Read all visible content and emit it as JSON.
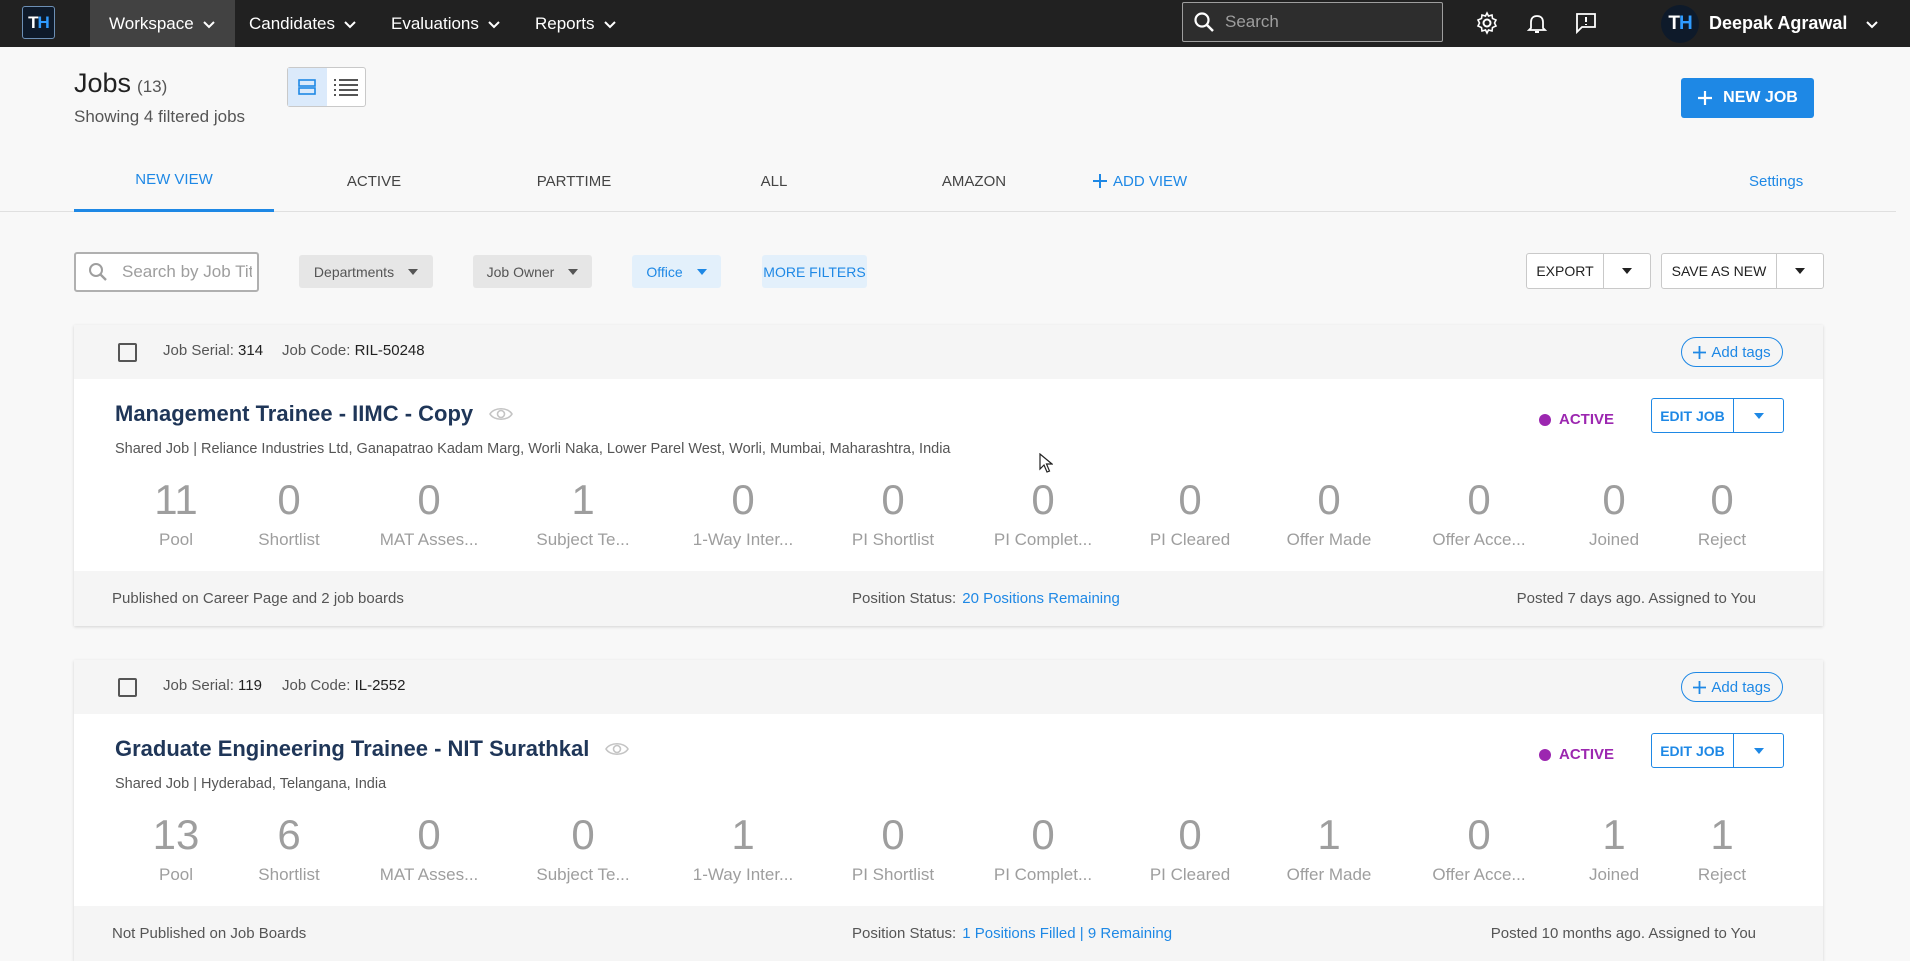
{
  "topbar": {
    "logo_t": "T",
    "logo_h": "H",
    "nav": [
      {
        "label": "Workspace"
      },
      {
        "label": "Candidates"
      },
      {
        "label": "Evaluations"
      },
      {
        "label": "Reports"
      }
    ],
    "search_placeholder": "Search",
    "user_name": "Deepak Agrawal",
    "user_initials_t": "T",
    "user_initials_h": "H"
  },
  "page": {
    "title": "Jobs",
    "count": "(13)",
    "subtitle": "Showing 4 filtered jobs",
    "new_job_label": "NEW JOB"
  },
  "tabs": [
    {
      "label": "NEW VIEW"
    },
    {
      "label": "ACTIVE"
    },
    {
      "label": "PARTTIME"
    },
    {
      "label": "ALL"
    },
    {
      "label": "AMAZON"
    }
  ],
  "add_view_label": "ADD VIEW",
  "settings_label": "Settings",
  "filters": {
    "search_placeholder": "Search by Job Title",
    "departments": "Departments",
    "job_owner": "Job Owner",
    "office": "Office",
    "more_filters": "MORE FILTERS",
    "export": "EXPORT",
    "save_as_new": "SAVE AS NEW"
  },
  "jobs": [
    {
      "serial_label": "Job Serial:",
      "serial": "314",
      "code_label": "Job Code:",
      "code": "RIL-50248",
      "add_tags": "Add tags",
      "title": "Management Trainee - IIMC - Copy",
      "location": "Shared Job | Reliance Industries Ltd, Ganapatrao Kadam Marg, Worli Naka, Lower Parel West, Worli, Mumbai, Maharashtra, India",
      "status": "ACTIVE",
      "edit": "EDIT JOB",
      "stages": [
        {
          "num": "11",
          "label": "Pool"
        },
        {
          "num": "0",
          "label": "Shortlist"
        },
        {
          "num": "0",
          "label": "MAT Asses..."
        },
        {
          "num": "1",
          "label": "Subject Te..."
        },
        {
          "num": "0",
          "label": "1-Way Inter..."
        },
        {
          "num": "0",
          "label": "PI Shortlist"
        },
        {
          "num": "0",
          "label": "PI Complet..."
        },
        {
          "num": "0",
          "label": "PI Cleared"
        },
        {
          "num": "0",
          "label": "Offer Made"
        },
        {
          "num": "0",
          "label": "Offer Acce..."
        },
        {
          "num": "0",
          "label": "Joined"
        },
        {
          "num": "0",
          "label": "Reject"
        }
      ],
      "footer_left": "Published on Career Page and 2 job boards",
      "position_label": "Position Status:",
      "position_value": "20 Positions Remaining",
      "footer_right": "Posted 7 days ago. Assigned to You"
    },
    {
      "serial_label": "Job Serial:",
      "serial": "119",
      "code_label": "Job Code:",
      "code": "IL-2552",
      "add_tags": "Add tags",
      "title": "Graduate Engineering Trainee - NIT Surathkal",
      "location": "Shared Job | Hyderabad, Telangana, India",
      "status": "ACTIVE",
      "edit": "EDIT JOB",
      "stages": [
        {
          "num": "13",
          "label": "Pool"
        },
        {
          "num": "6",
          "label": "Shortlist"
        },
        {
          "num": "0",
          "label": "MAT Asses..."
        },
        {
          "num": "0",
          "label": "Subject Te..."
        },
        {
          "num": "1",
          "label": "1-Way Inter..."
        },
        {
          "num": "0",
          "label": "PI Shortlist"
        },
        {
          "num": "0",
          "label": "PI Complet..."
        },
        {
          "num": "0",
          "label": "PI Cleared"
        },
        {
          "num": "1",
          "label": "Offer Made"
        },
        {
          "num": "0",
          "label": "Offer Acce..."
        },
        {
          "num": "1",
          "label": "Joined"
        },
        {
          "num": "1",
          "label": "Reject"
        }
      ],
      "footer_left": "Not Published on Job Boards",
      "position_label": "Position Status:",
      "position_value": "1 Positions Filled | 9 Remaining",
      "footer_right": "Posted 10 months ago. Assigned to You"
    }
  ]
}
